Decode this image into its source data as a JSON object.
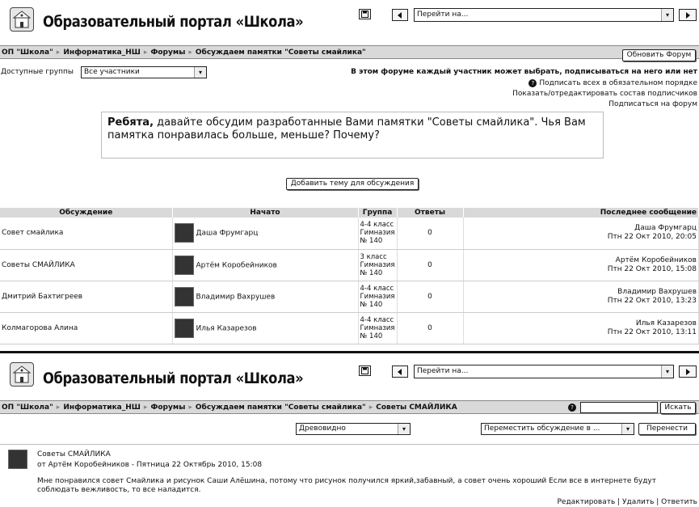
{
  "top": {
    "title": "Образовательный портал «Школа»",
    "jump_label": "Перейти на...",
    "breadcrumb": [
      "ОП \"Школа\"",
      "Информатика_НШ",
      "Форумы",
      "Обсуждаем памятки \"Советы смайлика\""
    ],
    "update_forum_button": "Обновить Форум",
    "groups_label": "Доступные группы",
    "groups_value": "Все участники",
    "subscription_info": "В этом форуме каждый участник может выбрать, подписываться на него или нет",
    "subscribe_all_link": "Подписать всех в обязательном порядке",
    "edit_subscribers_link": "Показать/отредактировать состав подписчиков",
    "subscribe_link": "Подписаться на форум",
    "intro_bold": "Ребята,",
    "intro_text": " давайте обсудим разработанные Вами памятки \"Советы смайлика\". Чья Вам памятка понравилась больше, меньше? Почему?",
    "add_topic_button": "Добавить тему для обсуждения",
    "table": {
      "headers": [
        "Обсуждение",
        "Начато",
        "Группа",
        "Ответы",
        "Последнее сообщение"
      ],
      "rows": [
        {
          "topic": "Совет смайлика",
          "author": "Даша Фрумгарц",
          "group": [
            "4-4 класс",
            "Гимназия",
            "№ 140"
          ],
          "replies": "0",
          "last_author": "Даша Фрумгарц",
          "last_date": "Птн 22 Окт 2010, 20:05"
        },
        {
          "topic": "Советы СМАЙЛИКА",
          "author": "Артём Коробейников",
          "group": [
            "3 класс",
            "Гимназия",
            "№ 140"
          ],
          "replies": "0",
          "last_author": "Артём Коробейников",
          "last_date": "Птн 22 Окт 2010, 15:08"
        },
        {
          "topic": "Дмитрий Бахтигреев",
          "author": "Владимир Вахрушев",
          "group": [
            "4-4 класс",
            "Гимназия",
            "№ 140"
          ],
          "replies": "0",
          "last_author": "Владимир Вахрушев",
          "last_date": "Птн 22 Окт 2010, 13:23"
        },
        {
          "topic": "Колмагорова Алина",
          "author": "Илья Казарезов",
          "group": [
            "4-4 класс",
            "Гимназия",
            "№ 140"
          ],
          "replies": "0",
          "last_author": "Илья Казарезов",
          "last_date": "Птн 22 Окт 2010, 13:11"
        }
      ]
    }
  },
  "bottom": {
    "title": "Образовательный портал «Школа»",
    "jump_label": "Перейти на...",
    "breadcrumb": [
      "ОП \"Школа\"",
      "Информатика_НШ",
      "Форумы",
      "Обсуждаем памятки \"Советы смайлика\"",
      "Советы СМАЙЛИКА"
    ],
    "search_button": "Искать",
    "display_mode": "Древовидно",
    "move_select": "Переместить обсуждение в ...",
    "move_button": "Перенести",
    "post_subject": "Советы СМАЙЛИКА",
    "post_from": "от Артём Коробейников - Пятница 22 Октябрь 2010, 15:08",
    "post_body": "Мне понравился совет Смайлика и рисунок Саши Алёшина, потому что рисунок получился яркий,забавный, а совет очень хороший Если все в интернете будут соблюдать вежливость, то все наладится.",
    "post_actions": "Редактировать | Удалить | Ответить"
  },
  "icons": {
    "logo": "school-building-icon",
    "help": "help-icon",
    "arrow_left": "arrow-left-icon",
    "arrow_right": "arrow-right-icon",
    "dropdown": "chevron-down-icon"
  }
}
